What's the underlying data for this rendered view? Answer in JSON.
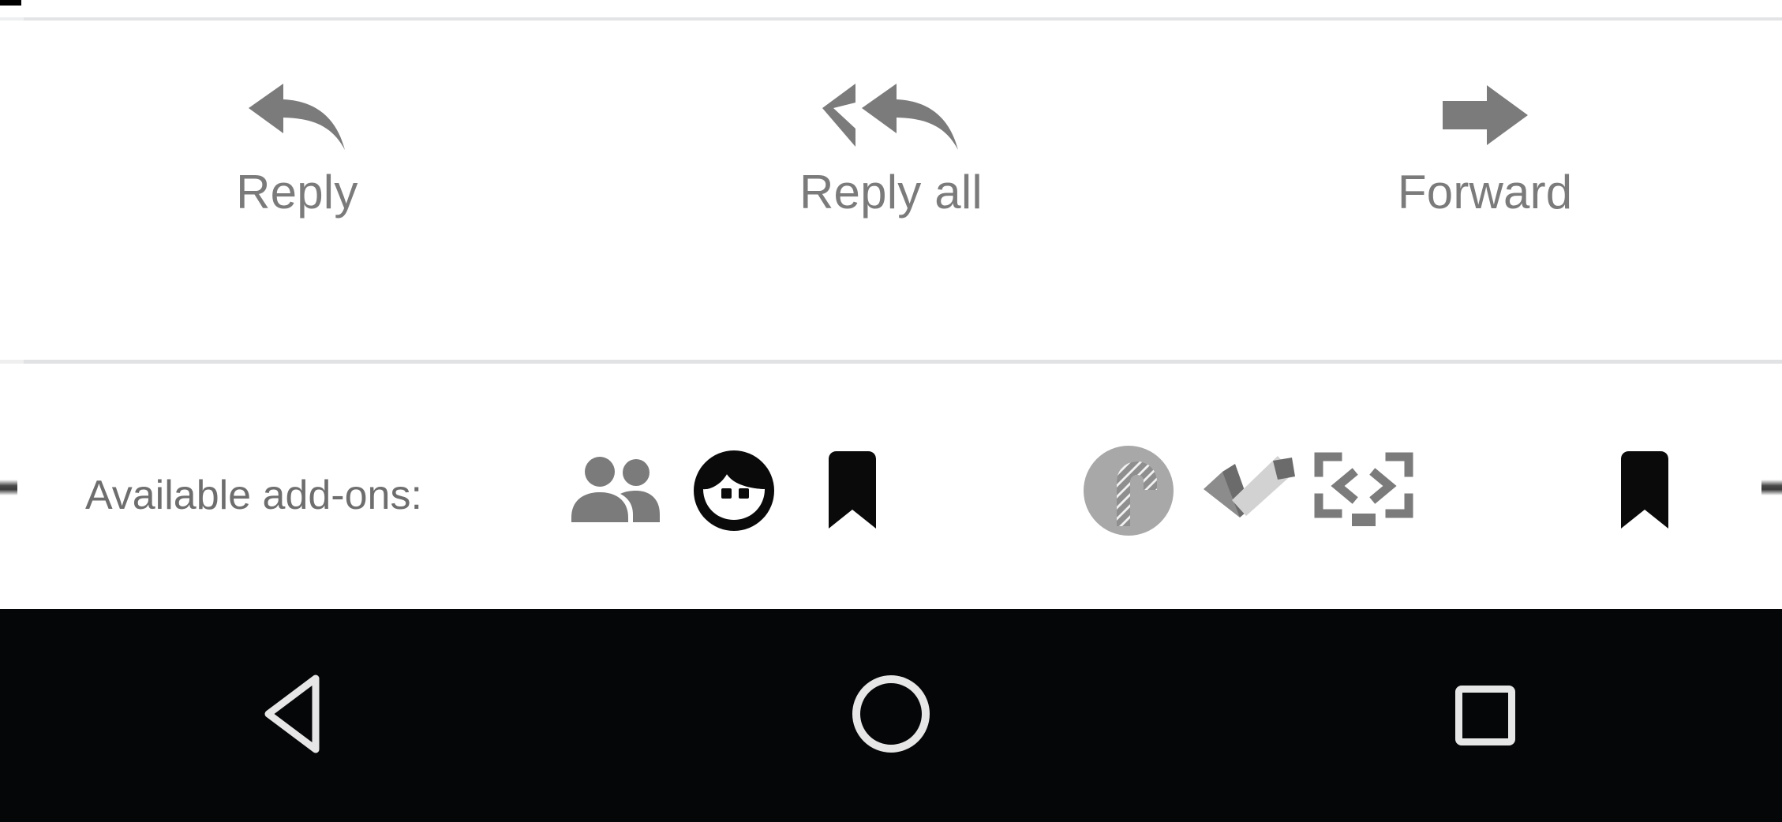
{
  "screen": {
    "app_context": "email-message-actions",
    "background_color": "#ffffff",
    "divider_color": "#e1e2e4",
    "label_color": "#7b7b7b",
    "icon_color": "#7b7b7b",
    "nav_bar_color": "#050607",
    "nav_icon_color": "#e6e6e6"
  },
  "action_bar": {
    "buttons": [
      {
        "id": "reply",
        "label": "Reply",
        "icon": "reply-arrow-icon"
      },
      {
        "id": "reply_all",
        "label": "Reply all",
        "icon": "reply-all-arrow-icon"
      },
      {
        "id": "forward",
        "label": "Forward",
        "icon": "forward-arrow-icon"
      }
    ]
  },
  "addons": {
    "label": "Available add-ons:",
    "items": [
      {
        "id": "contacts",
        "icon": "people-group-icon",
        "color": "#7b7b7b"
      },
      {
        "id": "avatar",
        "icon": "face-avatar-icon",
        "color": "#000000"
      },
      {
        "id": "bookmark_1",
        "icon": "bookmark-icon",
        "color": "#000000"
      },
      {
        "id": "candy_cane",
        "icon": "candy-cane-circle-icon",
        "color": "#a6a6a6"
      },
      {
        "id": "tasks",
        "icon": "checkmark-icon",
        "color": "#7b7b7b"
      },
      {
        "id": "code",
        "icon": "code-monitor-icon",
        "color": "#7b7b7b"
      },
      {
        "id": "bookmark_2",
        "icon": "bookmark-icon",
        "color": "#000000"
      }
    ],
    "edge_clipped_left": true,
    "edge_clipped_right": true
  },
  "nav_bar": {
    "buttons": [
      {
        "id": "back",
        "icon": "back-triangle-icon"
      },
      {
        "id": "home",
        "icon": "home-circle-icon"
      },
      {
        "id": "recents",
        "icon": "recents-square-icon"
      }
    ]
  }
}
